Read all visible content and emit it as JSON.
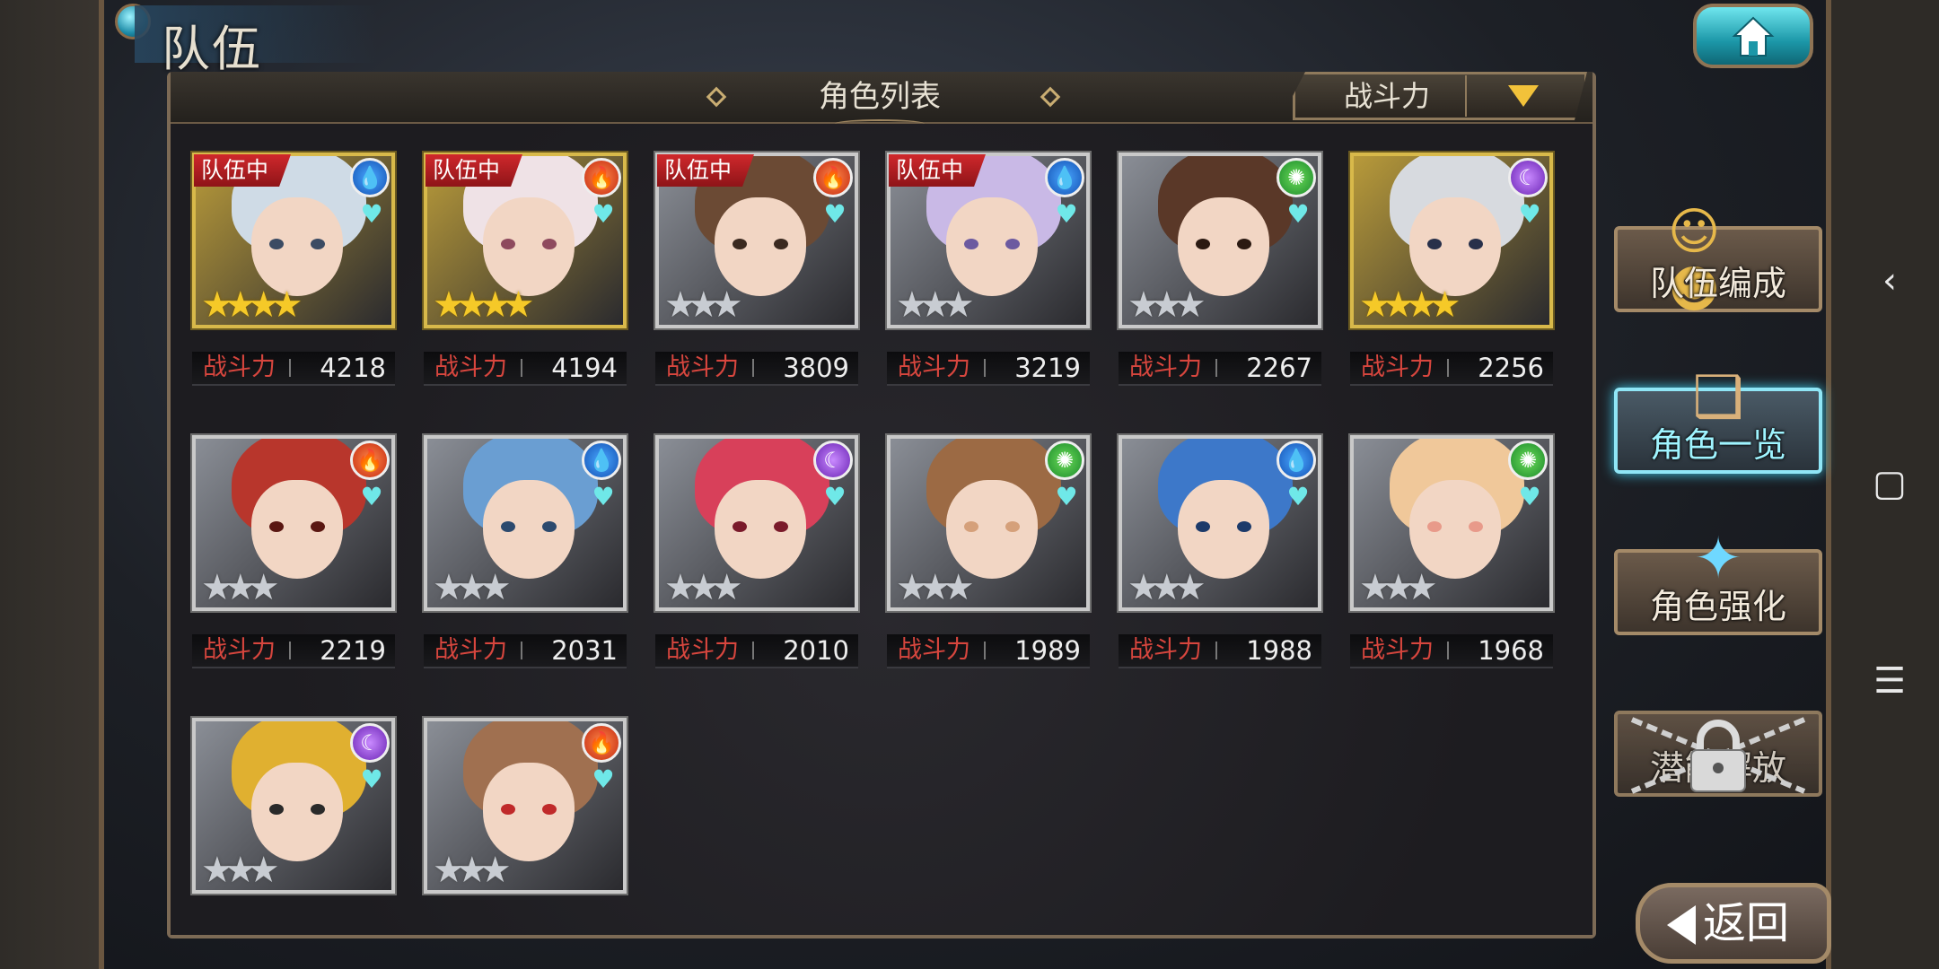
{
  "screen": {
    "title": "队伍",
    "header_title": "角色列表",
    "sort": {
      "label": "战斗力"
    }
  },
  "power_label": "战斗力",
  "characters": [
    {
      "in_team_badge": "队伍中",
      "element": "water",
      "element_icon": "droplet-icon",
      "stars": "★★★★",
      "star_tier": "gold",
      "frame": "gold",
      "power": "4218"
    },
    {
      "in_team_badge": "队伍中",
      "element": "fire",
      "element_icon": "flame-icon",
      "stars": "★★★★",
      "star_tier": "gold",
      "frame": "gold",
      "power": "4194"
    },
    {
      "in_team_badge": "队伍中",
      "element": "fire",
      "element_icon": "flame-icon",
      "stars": "★★★",
      "star_tier": "silver",
      "frame": "silver",
      "power": "3809"
    },
    {
      "in_team_badge": "队伍中",
      "element": "water",
      "element_icon": "droplet-icon",
      "stars": "★★★",
      "star_tier": "silver",
      "frame": "silver",
      "power": "3219"
    },
    {
      "in_team_badge": "",
      "element": "wind",
      "element_icon": "swirl-icon",
      "stars": "★★★",
      "star_tier": "silver",
      "frame": "silver",
      "power": "2267"
    },
    {
      "in_team_badge": "",
      "element": "dark",
      "element_icon": "moon-icon",
      "stars": "★★★★",
      "star_tier": "gold",
      "frame": "gold",
      "power": "2256"
    },
    {
      "in_team_badge": "",
      "element": "fire",
      "element_icon": "flame-icon",
      "stars": "★★★",
      "star_tier": "silver",
      "frame": "silver",
      "power": "2219"
    },
    {
      "in_team_badge": "",
      "element": "water",
      "element_icon": "droplet-icon",
      "stars": "★★★",
      "star_tier": "silver",
      "frame": "silver",
      "power": "2031"
    },
    {
      "in_team_badge": "",
      "element": "dark",
      "element_icon": "moon-icon",
      "stars": "★★★",
      "star_tier": "silver",
      "frame": "silver",
      "power": "2010"
    },
    {
      "in_team_badge": "",
      "element": "wind",
      "element_icon": "swirl-icon",
      "stars": "★★★",
      "star_tier": "silver",
      "frame": "silver",
      "power": "1989"
    },
    {
      "in_team_badge": "",
      "element": "water",
      "element_icon": "droplet-icon",
      "stars": "★★★",
      "star_tier": "silver",
      "frame": "silver",
      "power": "1988"
    },
    {
      "in_team_badge": "",
      "element": "wind",
      "element_icon": "swirl-icon",
      "stars": "★★★",
      "star_tier": "silver",
      "frame": "silver",
      "power": "1968"
    },
    {
      "in_team_badge": "",
      "element": "dark",
      "element_icon": "moon-icon",
      "stars": "★★★",
      "star_tier": "silver",
      "frame": "silver",
      "power": ""
    },
    {
      "in_team_badge": "",
      "element": "fire",
      "element_icon": "flame-icon",
      "stars": "★★★",
      "star_tier": "silver",
      "frame": "silver",
      "power": ""
    }
  ],
  "side_menu": [
    {
      "label": "队伍编成",
      "icon": "two-characters-icon",
      "active": false,
      "locked": false
    },
    {
      "label": "角色一览",
      "icon": "open-book-icon",
      "active": true,
      "locked": false
    },
    {
      "label": "角色强化",
      "icon": "enhance-crystal-icon",
      "active": false,
      "locked": false
    },
    {
      "label": "潜能解放",
      "icon": "padlock-chains-icon",
      "active": false,
      "locked": true
    }
  ],
  "back_button": {
    "label": "返回"
  },
  "colors": {
    "badge_red": "#c4161c",
    "power_label_red": "#d7463e",
    "active_cyan": "#8fe6f6",
    "gold_star": "#f5c928"
  }
}
